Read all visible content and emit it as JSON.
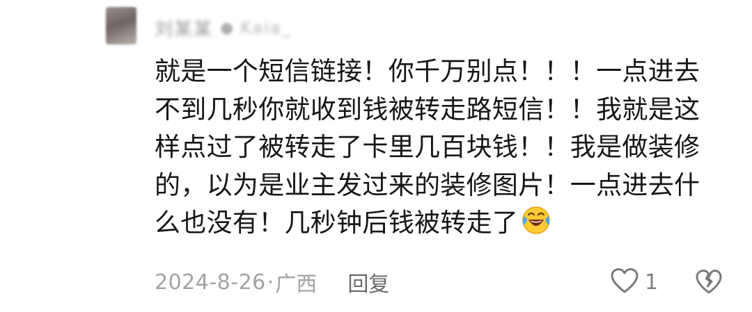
{
  "comment": {
    "author": {
      "name": "刘某某",
      "tag": "Kaia_"
    },
    "text_lines": [
      "就是一个短信链接！你千万别点！！！一点进去",
      "不到几秒你就收到钱被转走路短信！！我就是这",
      "样点过了被转走了卡里几百块钱！！我是做装修",
      "的，以为是业主发过来的装修图片！一点进去什",
      "么也没有！几秒钟后钱被转走了"
    ],
    "emoji": "face-with-tears-of-joy-icon",
    "date": "2024-8-26",
    "separator": "·",
    "location": "广西",
    "reply_label": "回复",
    "like_count": "1"
  },
  "colors": {
    "text": "#161616",
    "meta": "#a3a3a3",
    "icon": "#7a7a7a"
  }
}
